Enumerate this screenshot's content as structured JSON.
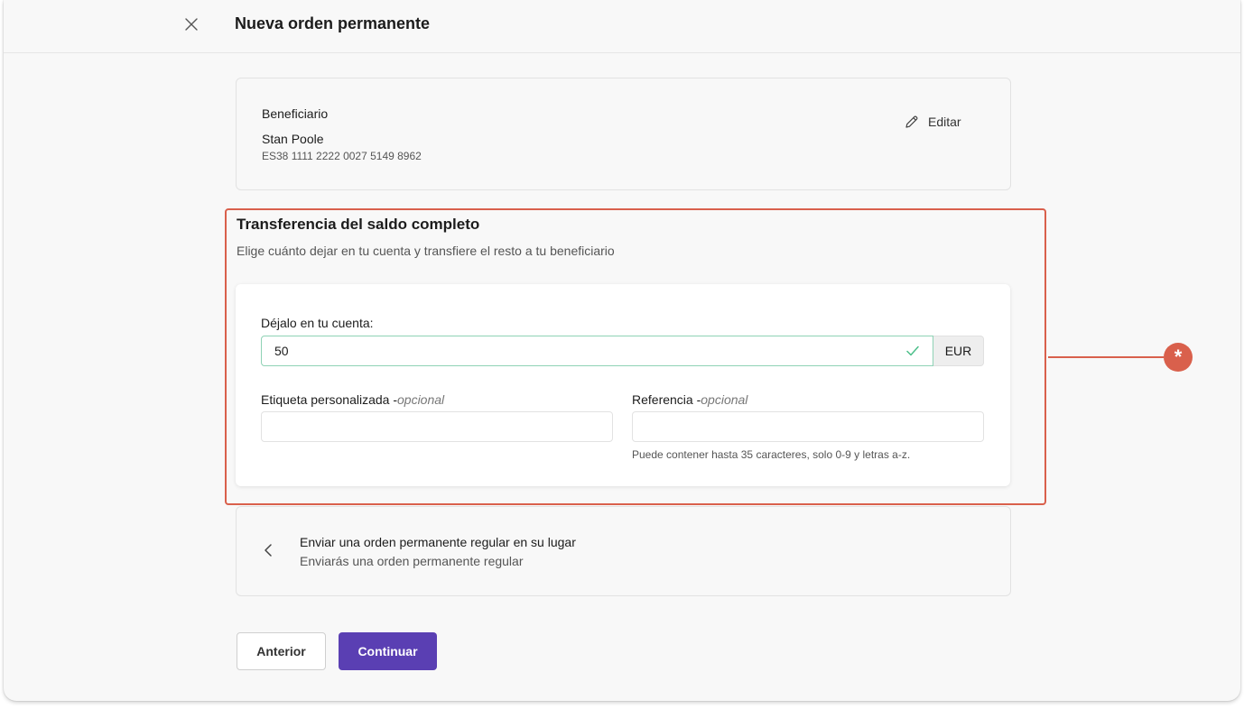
{
  "header": {
    "title": "Nueva orden permanente",
    "close_icon": "close-icon"
  },
  "beneficiary": {
    "heading": "Beneficiario",
    "name": "Stan Poole",
    "iban": "ES38 1111 2222 0027 5149 8962",
    "edit_label": "Editar",
    "edit_icon": "pencil-icon"
  },
  "full_balance": {
    "title": "Transferencia del saldo completo",
    "subtitle": "Elige cuánto dejar en tu cuenta y transfiere el resto a tu beneficiario",
    "leave_label": "Déjalo en tu cuenta:",
    "amount_value": "50",
    "amount_valid_icon": "check-icon",
    "currency": "EUR",
    "custom_label_title": "Etiqueta personalizada -",
    "custom_label_optional": "opcional",
    "custom_label_value": "",
    "reference_title": "Referencia -",
    "reference_optional": "opcional",
    "reference_value": "",
    "reference_helper": "Puede contener hasta 35 caracteres, solo 0-9 y letras a-z."
  },
  "annotation": {
    "marker": "*",
    "color": "#d9604c"
  },
  "regular_option": {
    "title": "Enviar una orden permanente regular en su lugar",
    "subtitle": "Enviarás una orden permanente regular",
    "icon": "chevron-left-icon"
  },
  "footer": {
    "previous_label": "Anterior",
    "continue_label": "Continuar"
  },
  "colors": {
    "primary": "#5a3fb3",
    "valid": "#8fd2b5",
    "annotation": "#d9604c"
  }
}
